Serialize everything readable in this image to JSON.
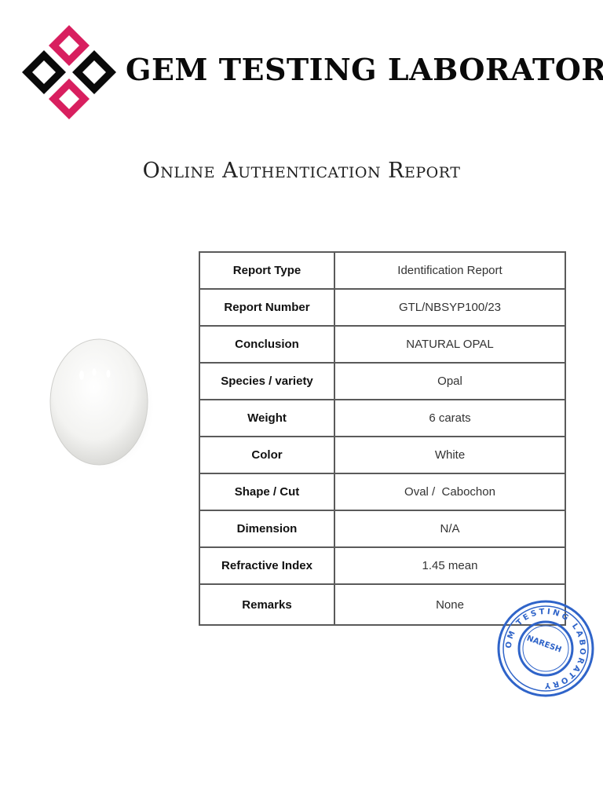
{
  "header": {
    "brand_name": "GEM TESTING LABORATORY",
    "logo_icon": "diamond-cluster-logo",
    "colors": {
      "accent": "#d81f5f",
      "outline": "#0a0a0a"
    }
  },
  "title": "Online Authentication Report",
  "gem_image": {
    "icon": "white-oval-cabochon"
  },
  "report_table": {
    "rows": [
      {
        "label": "Report Type",
        "value": "Identification Report"
      },
      {
        "label": "Report Number",
        "value": "GTL/NBSYP100/23"
      },
      {
        "label": "Conclusion",
        "value": "NATURAL OPAL"
      },
      {
        "label": "Species / variety",
        "value": "Opal"
      },
      {
        "label": "Weight",
        "value": "6 carats"
      },
      {
        "label": "Color",
        "value": "White"
      },
      {
        "label": "Shape / Cut",
        "value": "Oval /  Cabochon"
      },
      {
        "label": "Dimension",
        "value": "N/A"
      },
      {
        "label": "Refractive Index",
        "value": "1.45 mean"
      },
      {
        "label": "Remarks",
        "value": "None"
      }
    ]
  },
  "stamp": {
    "ring_text": "OM TESTING LABORATORY",
    "center_text": "NARESH",
    "color": "#2f64c9"
  }
}
